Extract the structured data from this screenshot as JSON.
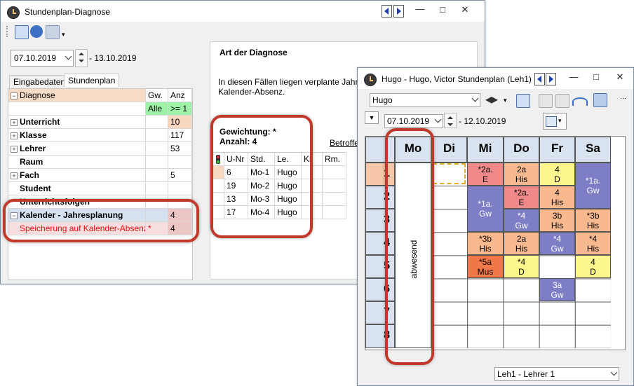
{
  "diag_window": {
    "title": "Stundenplan-Diagnose",
    "date_from": "07.10.2019",
    "date_to": "- 13.10.2019",
    "tabs": [
      "Eingabedaten",
      "Stundenplan"
    ],
    "tree_header": {
      "col1": "Diagnose",
      "col2": "Gw.",
      "col3": "Anz"
    },
    "filter_row": {
      "gw": "Alle",
      "anz": ">= 1"
    },
    "tree_rows": [
      {
        "label": "Unterricht",
        "gw": "",
        "anz": "10"
      },
      {
        "label": "Klasse",
        "gw": "",
        "anz": "117"
      },
      {
        "label": "Lehrer",
        "gw": "",
        "anz": "53"
      },
      {
        "label": "Raum",
        "gw": "",
        "anz": ""
      },
      {
        "label": "Fach",
        "gw": "",
        "anz": "5"
      },
      {
        "label": "Student",
        "gw": "",
        "anz": ""
      },
      {
        "label": "Unterrichtsfolgen",
        "gw": "",
        "anz": ""
      },
      {
        "label": "Kalender - Jahresplanung",
        "gw": "",
        "anz": "4"
      },
      {
        "label": "Speicherung auf Kalender-Absenz",
        "gw": "*",
        "anz": "4"
      }
    ],
    "detail_title": "Art der Diagnose",
    "detail_text_1": "In diesen Fällen liegen verplante Jahresstu",
    "detail_text_2": "Kalender-Absenz.",
    "gewichtung": "Gewichtung: *",
    "anzahl": "Anzahl: 4",
    "betroffen": "Betroffen",
    "result_header": {
      "unr": "U-Nr",
      "std": "Std.",
      "le": "Le.",
      "kl": "Kl.",
      "rm": "Rm."
    },
    "result_rows": [
      {
        "unr": "6",
        "std": "Mo-1",
        "le": "Hugo"
      },
      {
        "unr": "19",
        "std": "Mo-2",
        "le": "Hugo"
      },
      {
        "unr": "13",
        "std": "Mo-3",
        "le": "Hugo"
      },
      {
        "unr": "17",
        "std": "Mo-4",
        "le": "Hugo"
      }
    ]
  },
  "plan_window": {
    "title": "Hugo - Hugo, Victor  Stundenplan  (Leh1)",
    "element_select": "Hugo",
    "date_from": "07.10.2019",
    "date_to": "- 12.10.2019",
    "days": [
      "Mo",
      "Di",
      "Mi",
      "Do",
      "Fr",
      "Sa"
    ],
    "periods": [
      "1",
      "2",
      "3",
      "4",
      "5",
      "6",
      "7",
      "8"
    ],
    "absent_label": "abwesend",
    "lessons": {
      "mi1": {
        "l1": "*2a.",
        "l2": "E"
      },
      "do1": {
        "l1": "2a",
        "l2": "His"
      },
      "fr1": {
        "l1": "4",
        "l2": "D"
      },
      "sa12": {
        "l1": "*1a.",
        "l2": "Gw"
      },
      "do2": {
        "l1": "*2a.",
        "l2": "E"
      },
      "fr2": {
        "l1": "4",
        "l2": "His"
      },
      "mi23": {
        "l1": "*1a.",
        "l2": "Gw"
      },
      "do3": {
        "l1": "*4",
        "l2": "Gw"
      },
      "fr3": {
        "l1": "3b",
        "l2": "His"
      },
      "sa3": {
        "l1": "*3b",
        "l2": "His"
      },
      "mi4": {
        "l1": "*3b",
        "l2": "His"
      },
      "do4": {
        "l1": "2a",
        "l2": "His"
      },
      "fr4": {
        "l1": "*4",
        "l2": "Gw"
      },
      "sa4": {
        "l1": "*4",
        "l2": "His"
      },
      "mi5": {
        "l1": "*5a",
        "l2": "Mus"
      },
      "do5": {
        "l1": "*4",
        "l2": "D"
      },
      "sa5": {
        "l1": "4",
        "l2": "D"
      },
      "fr6": {
        "l1": "3a",
        "l2": "Gw"
      }
    },
    "format_select": "Leh1 - Lehrer 1"
  }
}
